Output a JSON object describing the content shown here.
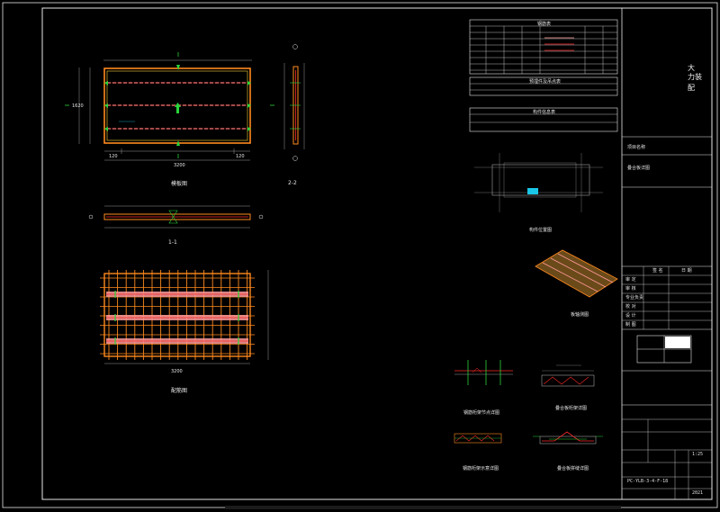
{
  "drawing": {
    "views": {
      "plan": {
        "caption": "模板图"
      },
      "section_1": {
        "caption": "1-1"
      },
      "section_2": {
        "caption": "2-2"
      },
      "rebar": {
        "caption": "配筋图"
      },
      "location": {
        "caption": "构件位置图"
      },
      "iso": {
        "caption": "板轴测图"
      },
      "detail_a": {
        "caption": "钢筋桁架节点详图"
      },
      "detail_b": {
        "caption": "叠合板桁架详图"
      },
      "detail_c": {
        "caption": "钢筋桁架示意详图"
      },
      "detail_d": {
        "caption": "叠合板拼缝详图"
      }
    },
    "dimensions": {
      "plan_total": "3200",
      "plan_left": "120",
      "plan_right": "120",
      "plan_height": "1620",
      "rebar_total": "3200"
    },
    "tables": {
      "rebar_table": {
        "title": "钢筋表"
      },
      "embed_table": {
        "title": "预埋件及吊点表"
      },
      "component_table": {
        "title": "构件信息表"
      }
    }
  },
  "title_block": {
    "company_lines": [
      "大",
      "力",
      "装",
      "配"
    ],
    "project_label": "项目名称",
    "drawing_name": "叠合板详图",
    "sheet_code": "PC-YLB-3-4-F-18",
    "scale": "1:25",
    "date": "2021",
    "row_labels": [
      "审 定",
      "审 核",
      "专业负责",
      "校 对",
      "设 计",
      "制 图"
    ],
    "col_a": "签 名",
    "col_b": "日 期"
  },
  "colors": {
    "frame": "#ffffff",
    "border_orange": "#ff8a1e",
    "rebar_red": "#ff2a2a",
    "pink_band": "#ff9a9a",
    "green_mark": "#2bd43b",
    "cyan_mark": "#19c6e6",
    "dim_gray": "#bfbfbf"
  }
}
